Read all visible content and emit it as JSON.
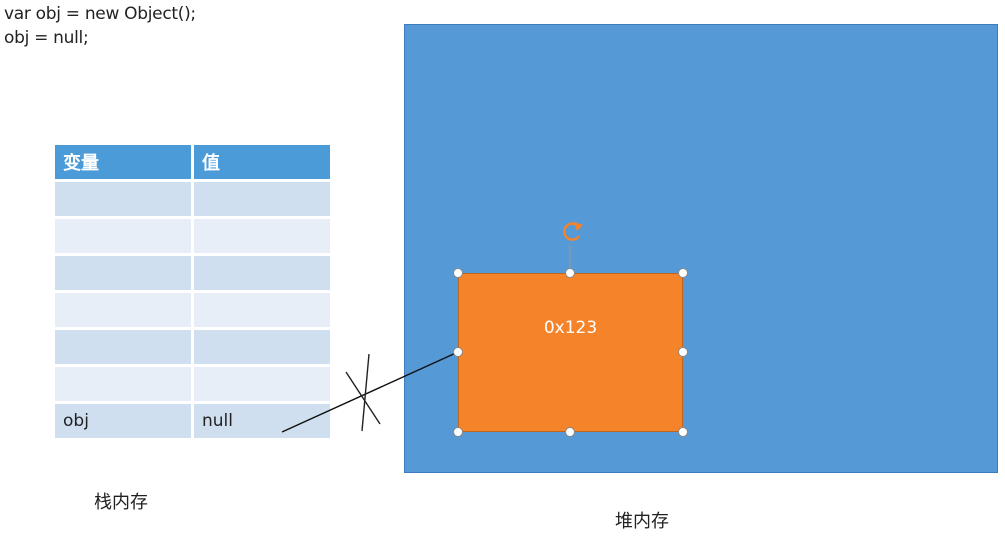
{
  "code": {
    "line1": "var obj = new Object();",
    "line2": "obj = null;"
  },
  "stack_table": {
    "headers": [
      "变量",
      "值"
    ],
    "last_row": {
      "name": "obj",
      "value": "null"
    },
    "empty_rows": 6
  },
  "stack_caption": "栈内存",
  "heap_caption": "堆内存",
  "heap_object": {
    "address": "0x123"
  },
  "colors": {
    "heap": "#5599d6",
    "object": "#f5832a",
    "table_header": "#4b9bd9",
    "table_row_a": "#cfdff0",
    "table_row_b": "#e7eef8"
  },
  "icons": [
    "rotate-handle-icon",
    "resize-handle-icon",
    "cross-mark-icon"
  ]
}
